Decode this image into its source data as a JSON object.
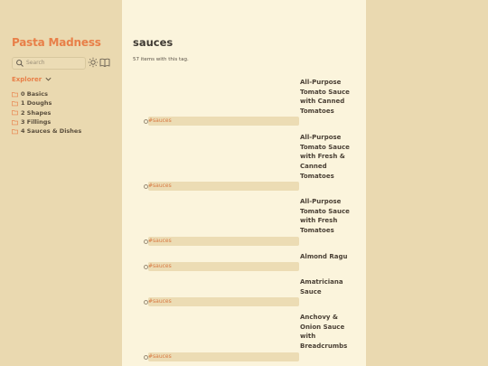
{
  "site": {
    "title": "Pasta Madness"
  },
  "search": {
    "placeholder": "Search"
  },
  "icons": {
    "search": "search-icon",
    "theme_toggle": "sun-icon",
    "reader_mode": "book-open-icon",
    "explorer_toggle": "chevron-down-icon",
    "folder": "folder-icon"
  },
  "explorer": {
    "label": "Explorer",
    "folders": [
      {
        "label": "0 Basics"
      },
      {
        "label": "1 Doughs"
      },
      {
        "label": "2 Shapes"
      },
      {
        "label": "3 Fillings"
      },
      {
        "label": "4 Sauces & Dishes"
      }
    ]
  },
  "page": {
    "title": "sauces",
    "count_text": "57 items with this tag."
  },
  "items": [
    {
      "title": "All-Purpose Tomato Sauce with Canned Tomatoes",
      "tag": "#sauces"
    },
    {
      "title": "All-Purpose Tomato Sauce with Fresh & Canned Tomatoes",
      "tag": "#sauces"
    },
    {
      "title": "All-Purpose Tomato Sauce with Fresh Tomatoes",
      "tag": "#sauces"
    },
    {
      "title": "Almond Ragu",
      "tag": "#sauces"
    },
    {
      "title": "Amatriciana Sauce",
      "tag": "#sauces"
    },
    {
      "title": "Anchovy & Onion Sauce with Breadcrumbs",
      "tag": "#sauces"
    }
  ],
  "colors": {
    "accent": "#e87f48",
    "sidebar_bg": "#ead9b0",
    "content_bg": "#fbf4dc",
    "tag_bg": "#ecdcb4",
    "text": "#4a4035"
  }
}
